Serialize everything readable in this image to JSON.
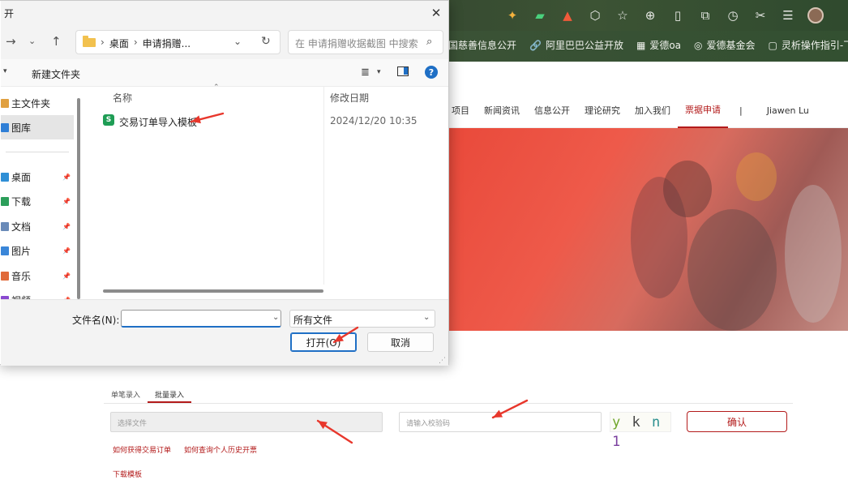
{
  "dialog": {
    "title": "开",
    "breadcrumb": [
      "桌面",
      "申请捐赠..."
    ],
    "search_placeholder": "在 申请捐赠收据截图 中搜索",
    "new_folder": "新建文件夹",
    "sidebar": [
      {
        "label": "主文件夹",
        "icon_color": "#e0a040",
        "pinned": false
      },
      {
        "label": "图库",
        "icon_color": "#2f7fd6",
        "pinned": false
      },
      {
        "label": "桌面",
        "icon_color": "#2f8fd6",
        "pinned": true
      },
      {
        "label": "下载",
        "icon_color": "#2c9e5a",
        "pinned": true
      },
      {
        "label": "文档",
        "icon_color": "#6a8ab8",
        "pinned": true
      },
      {
        "label": "图片",
        "icon_color": "#3a86d8",
        "pinned": true
      },
      {
        "label": "音乐",
        "icon_color": "#e06a3a",
        "pinned": true
      },
      {
        "label": "视频",
        "icon_color": "#8a4ad0",
        "pinned": true
      }
    ],
    "columns": {
      "name": "名称",
      "modified": "修改日期"
    },
    "files": [
      {
        "name": "交易订单导入模板",
        "modified": "2024/12/20 10:35",
        "icon_label": "S"
      }
    ],
    "filename_label": "文件名(N):",
    "filename_value": "",
    "filetype": "所有文件",
    "open_button": "打开(O)",
    "cancel_button": "取消",
    "help_icon_label": "?"
  },
  "bookmarks": [
    {
      "label": "国慈善信息公开",
      "icon": ""
    },
    {
      "label": "阿里巴巴公益开放",
      "icon": "🔗"
    },
    {
      "label": "爱德oa",
      "icon": "▦"
    },
    {
      "label": "爱德基金会",
      "icon": "◎"
    },
    {
      "label": "灵析操作指引-飞书",
      "icon": "▢"
    }
  ],
  "site": {
    "nav": [
      "项目",
      "新闻资讯",
      "信息公开",
      "理论研究",
      "加入我们",
      "票据申请"
    ],
    "nav_active": "票据申请",
    "nav_separator": "|",
    "user_name": "Jiawen Lu",
    "tabs": [
      {
        "label": "单笔录入",
        "active": false
      },
      {
        "label": "批量录入",
        "active": true
      }
    ],
    "file_placeholder": "选择文件",
    "code_placeholder": "请输入校验码",
    "captcha": [
      "y",
      "k",
      "n",
      "1"
    ],
    "confirm_button": "确认",
    "help_links": [
      "如何获得交易订单",
      "如何查询个人历史开票"
    ],
    "download_link": "下载模板"
  },
  "colors": {
    "accent_red": "#b31b1b",
    "windows_blue": "#1f6fc5",
    "annotation_arrow": "#e8372c"
  }
}
